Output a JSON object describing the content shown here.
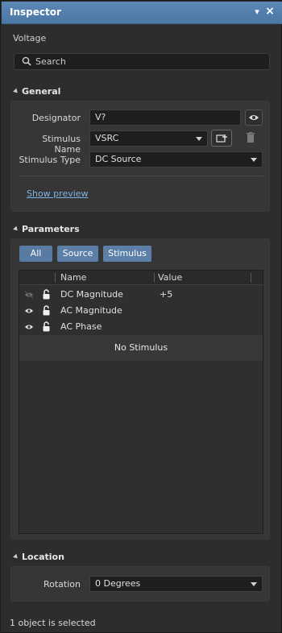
{
  "window": {
    "title": "Inspector",
    "subtitle": "Voltage",
    "pin_glyph": "▾",
    "close_glyph": "×"
  },
  "search": {
    "placeholder": "Search"
  },
  "general": {
    "heading": "General",
    "designator_label": "Designator",
    "designator_value": "V?",
    "stimulus_name_label": "Stimulus Name",
    "stimulus_name_value": "VSRC",
    "stimulus_type_label": "Stimulus Type",
    "stimulus_type_value": "DC Source",
    "show_preview": "Show preview"
  },
  "parameters": {
    "heading": "Parameters",
    "filters": [
      "All",
      "Source",
      "Stimulus"
    ],
    "columns": {
      "name": "Name",
      "value": "Value"
    },
    "rows": [
      {
        "name": "DC Magnitude",
        "value": "+5",
        "visible": false
      },
      {
        "name": "AC Magnitude",
        "value": "",
        "visible": true
      },
      {
        "name": "AC Phase",
        "value": "",
        "visible": true
      }
    ],
    "empty_message": "No Stimulus"
  },
  "location": {
    "heading": "Location",
    "rotation_label": "Rotation",
    "rotation_value": "0 Degrees"
  },
  "status": {
    "text": "1 object is selected"
  },
  "colors": {
    "title_bar": "#4d77a4",
    "accent_button": "#5b7fa6",
    "link": "#7fb2e5",
    "background": "#2d2d2d"
  }
}
